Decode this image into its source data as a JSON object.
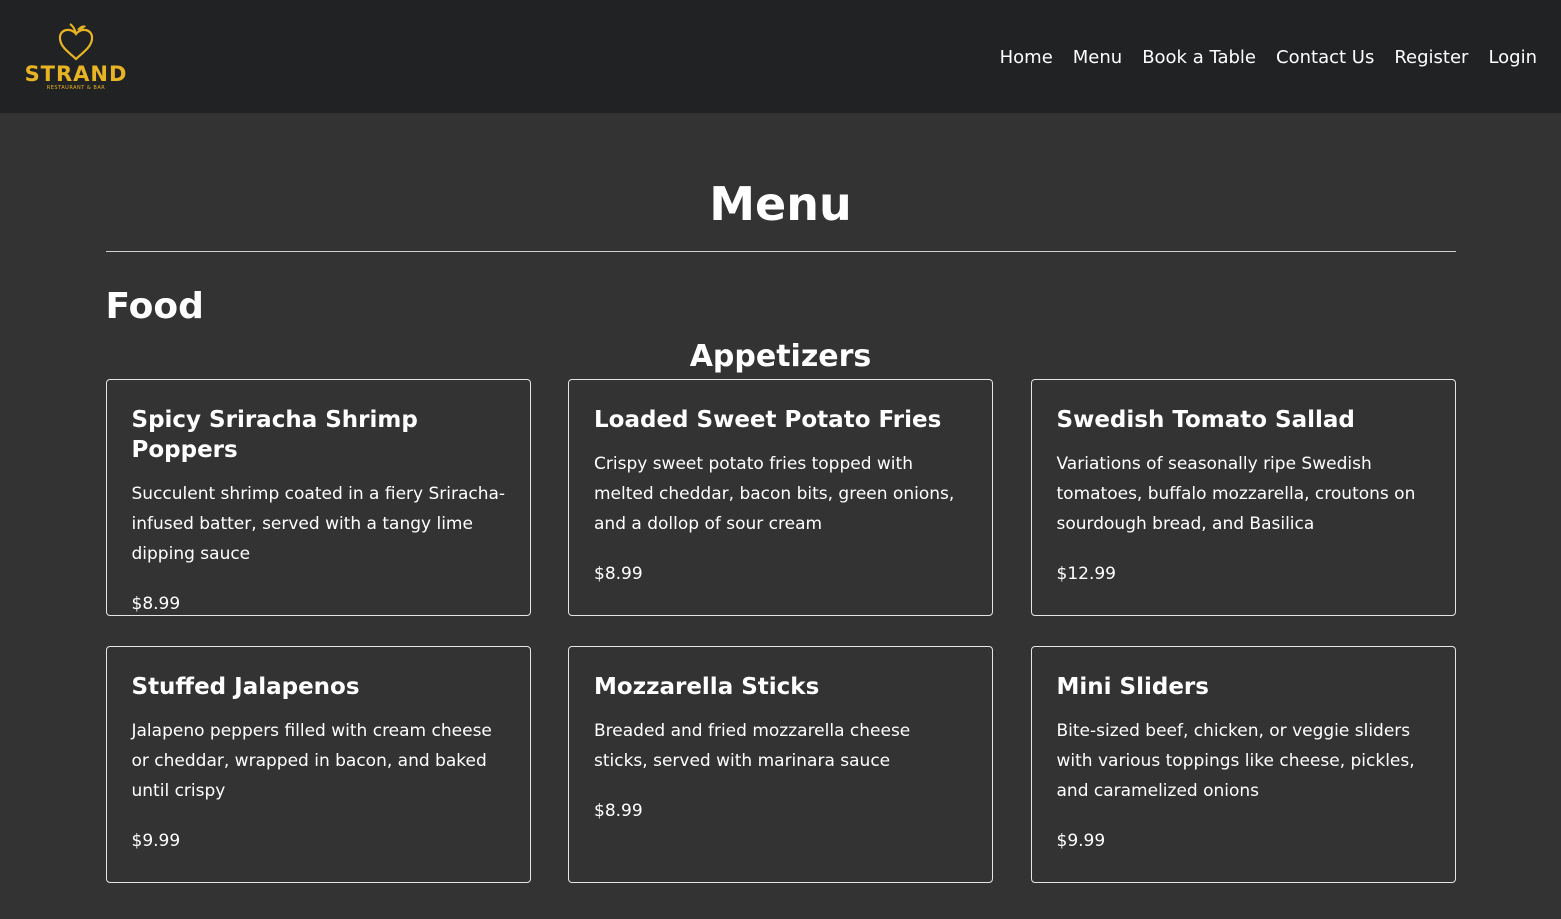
{
  "brand": {
    "name": "STRAND",
    "tagline": "RESTAURANT & BAR",
    "color": "#e8b423"
  },
  "nav": [
    {
      "label": "Home",
      "name": "nav-home"
    },
    {
      "label": "Menu",
      "name": "nav-menu"
    },
    {
      "label": "Book a Table",
      "name": "nav-book-a-table"
    },
    {
      "label": "Contact Us",
      "name": "nav-contact-us"
    },
    {
      "label": "Register",
      "name": "nav-register"
    },
    {
      "label": "Login",
      "name": "nav-login"
    }
  ],
  "page": {
    "title": "Menu",
    "section": "Food",
    "subsection": "Appetizers"
  },
  "items": [
    {
      "name": "Spicy Sriracha Shrimp Poppers",
      "desc": "Succulent shrimp coated in a fiery Sriracha-infused batter, served with a tangy lime dipping sauce",
      "price": "$8.99"
    },
    {
      "name": "Loaded Sweet Potato Fries",
      "desc": "Crispy sweet potato fries topped with melted cheddar, bacon bits, green onions, and a dollop of sour cream",
      "price": "$8.99"
    },
    {
      "name": "Swedish Tomato Sallad",
      "desc": "Variations of seasonally ripe Swedish tomatoes, buffalo mozzarella, croutons on sourdough bread, and Basilica",
      "price": "$12.99"
    },
    {
      "name": "Stuffed Jalapenos",
      "desc": "Jalapeno peppers filled with cream cheese or cheddar, wrapped in bacon, and baked until crispy",
      "price": "$9.99"
    },
    {
      "name": "Mozzarella Sticks",
      "desc": "Breaded and fried mozzarella cheese sticks, served with marinara sauce",
      "price": "$8.99"
    },
    {
      "name": "Mini Sliders",
      "desc": "Bite-sized beef, chicken, or veggie sliders with various toppings like cheese, pickles, and caramelized onions",
      "price": "$9.99"
    }
  ]
}
